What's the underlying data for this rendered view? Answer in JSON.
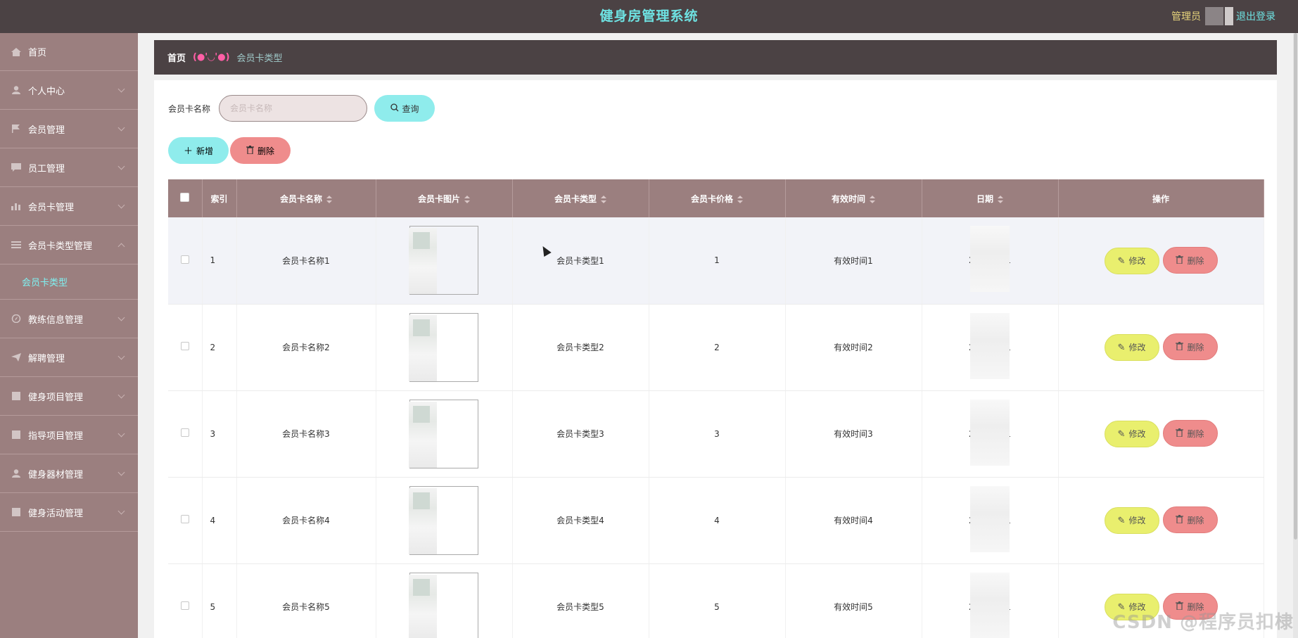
{
  "header": {
    "title": "健身房管理系统",
    "role": "管理员",
    "logout": "退出登录"
  },
  "sidebar": {
    "items": [
      {
        "label": "首页",
        "icon": "home-icon"
      },
      {
        "label": "个人中心",
        "icon": "user-icon"
      },
      {
        "label": "会员管理",
        "icon": "flag-icon"
      },
      {
        "label": "员工管理",
        "icon": "chat-icon"
      },
      {
        "label": "会员卡管理",
        "icon": "chart-icon"
      },
      {
        "label": "会员卡类型管理",
        "icon": "list-icon"
      },
      {
        "label": "会员卡类型",
        "icon": "",
        "sub": true
      },
      {
        "label": "教练信息管理",
        "icon": "compass-icon"
      },
      {
        "label": "解聘管理",
        "icon": "send-icon"
      },
      {
        "label": "健身项目管理",
        "icon": "doc-icon"
      },
      {
        "label": "指导项目管理",
        "icon": "doc-icon"
      },
      {
        "label": "健身器材管理",
        "icon": "user-icon"
      },
      {
        "label": "健身活动管理",
        "icon": "doc-icon"
      }
    ]
  },
  "breadcrumb": {
    "home": "首页",
    "separator": "(●'◡'●)",
    "current": "会员卡类型"
  },
  "search": {
    "label": "会员卡名称",
    "placeholder": "会员卡名称",
    "button": "查询"
  },
  "actions": {
    "add": "新增",
    "delete": "删除"
  },
  "table": {
    "columns": [
      "索引",
      "会员卡名称",
      "会员卡图片",
      "会员卡类型",
      "会员卡价格",
      "有效时间",
      "日期",
      "操作"
    ],
    "rows": [
      {
        "index": "1",
        "name": "会员卡名称1",
        "type": "会员卡类型1",
        "price": "1",
        "valid": "有效时间1",
        "date_prefix": "2(",
        "date_suffix": "1"
      },
      {
        "index": "2",
        "name": "会员卡名称2",
        "type": "会员卡类型2",
        "price": "2",
        "valid": "有效时间2",
        "date_prefix": "2(",
        "date_suffix": "1"
      },
      {
        "index": "3",
        "name": "会员卡名称3",
        "type": "会员卡类型3",
        "price": "3",
        "valid": "有效时间3",
        "date_prefix": "2(",
        "date_suffix": "1"
      },
      {
        "index": "4",
        "name": "会员卡名称4",
        "type": "会员卡类型4",
        "price": "4",
        "valid": "有效时间4",
        "date_prefix": "2(",
        "date_suffix": "1"
      },
      {
        "index": "5",
        "name": "会员卡名称5",
        "type": "会员卡类型5",
        "price": "5",
        "valid": "有效时间5",
        "date_prefix": "2(",
        "date_suffix": "1"
      }
    ],
    "edit_label": "修改",
    "delete_label": "删除"
  },
  "watermark": "CSDN @程序员扣棣",
  "colors": {
    "topbar": "#4b4244",
    "sidebar": "#9b7f7f",
    "accent_cyan": "#8fecec",
    "danger": "#ef8c8c",
    "edit": "#e9ef6e"
  }
}
